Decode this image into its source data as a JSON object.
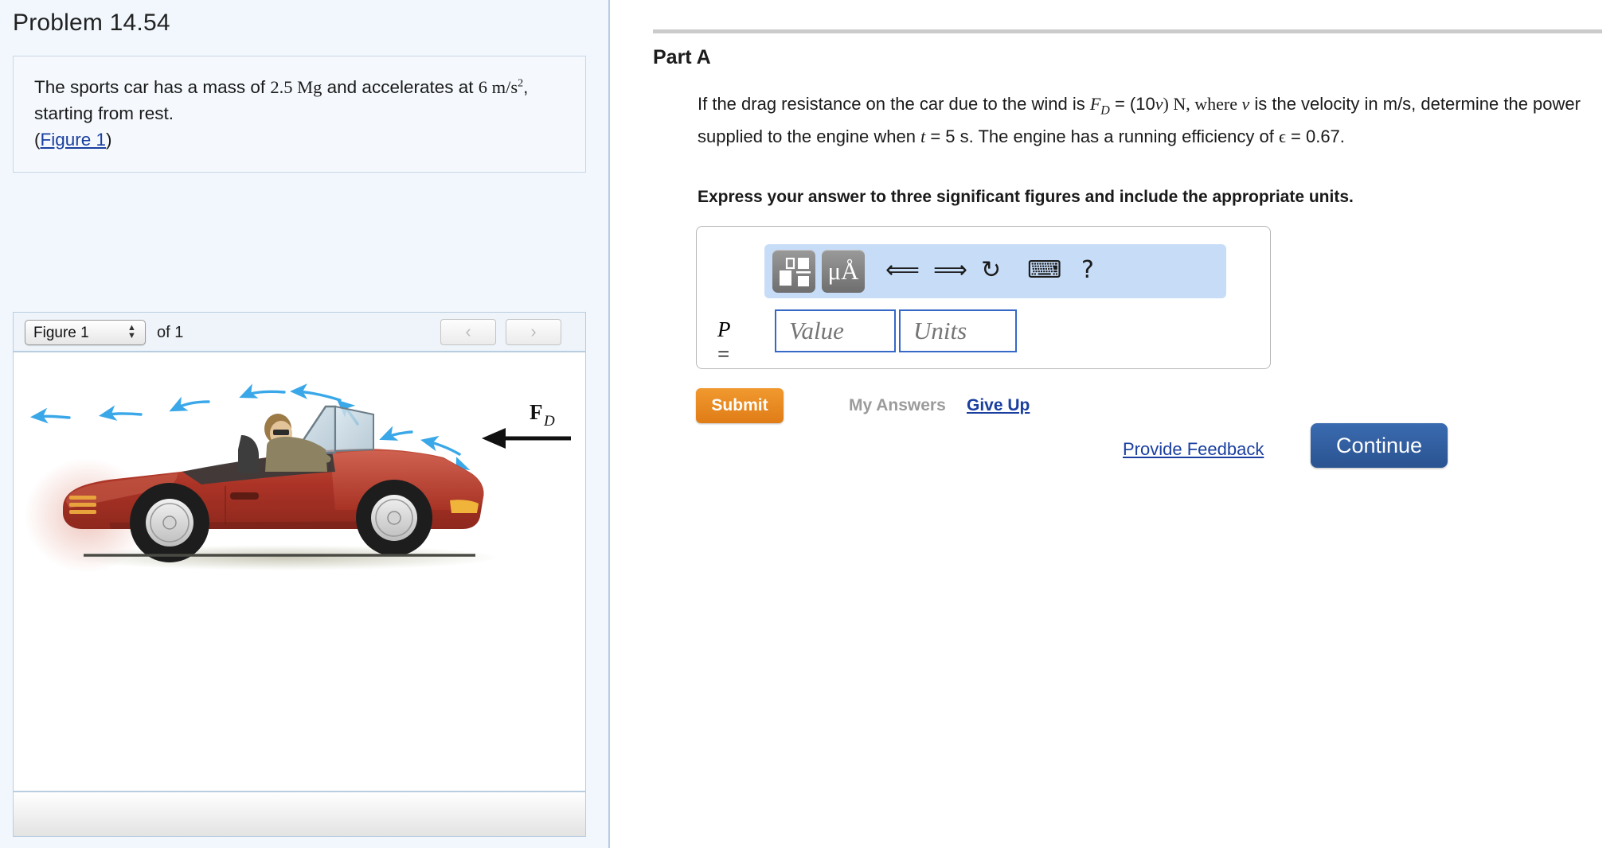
{
  "problem": {
    "title": "Problem 14.54",
    "statement_part1": "The sports car has a mass of ",
    "statement_mass": "2.5 Mg",
    "statement_part2": " and accelerates at ",
    "statement_accel_num": "6 m/s",
    "statement_accel_exp": "2",
    "statement_part3": ", starting from rest.",
    "figure_link_open": "(",
    "figure_link": "Figure 1",
    "figure_link_close": ")"
  },
  "figure_panel": {
    "selected_figure": "Figure 1",
    "options": [
      "Figure 1"
    ],
    "of_label": "of 1",
    "prev_label": "‹",
    "next_label": "›",
    "force_label_main": "F",
    "force_label_sub": "D"
  },
  "part": {
    "title": "Part A",
    "q_seg1": "If the drag resistance on the car due to the wind is ",
    "q_fd_main": "F",
    "q_fd_sub": "D",
    "q_seg2": " = (10",
    "q_v1": "v",
    "q_seg3": ") N, where ",
    "q_v2": "v",
    "q_seg4": " is the velocity in m/s, determine the power supplied to the engine when ",
    "q_t": "t",
    "q_seg5": " = 5 s. The engine has a running efficiency of ",
    "q_eps": "ϵ",
    "q_seg6": " = 0.67.",
    "express_note": "Express your answer to three significant figures and include the appropriate units."
  },
  "answer": {
    "p_label_var": "P",
    "p_label_eq": " =",
    "value_placeholder": "Value",
    "units_placeholder": "Units",
    "value_text": "",
    "units_text": "",
    "toolbar": {
      "template_icon": "template-icon",
      "units_icon": "μÅ",
      "undo_icon": "⮌",
      "redo_icon": "⮍",
      "reset_icon": "↻",
      "keyboard_icon": "⌨",
      "help_icon": "?"
    }
  },
  "actions": {
    "submit": "Submit",
    "my_answers": "My Answers",
    "give_up": "Give Up",
    "provide_feedback": "Provide Feedback",
    "continue": "Continue"
  },
  "colors": {
    "submit_orange": "#e8892b",
    "continue_blue": "#2b5699",
    "link_blue": "#1a3fa0",
    "panel_bg": "#f1f7fd",
    "toolbar_blue": "#c6dcf7",
    "field_border": "#3668c8",
    "car_body": "#b5392c"
  }
}
